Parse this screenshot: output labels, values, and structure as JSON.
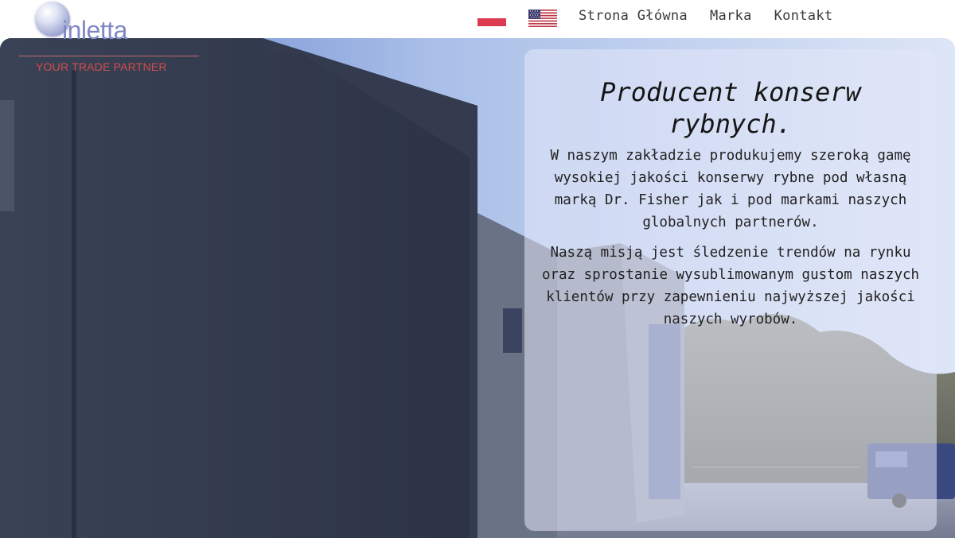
{
  "logo": {
    "word": "inletta",
    "tagline": "YOUR TRADE PARTNER"
  },
  "header": {
    "flags": [
      {
        "name": "polish-flag-icon"
      },
      {
        "name": "us-flag-icon"
      }
    ],
    "nav": [
      {
        "label": "Strona Główna"
      },
      {
        "label": "Marka"
      },
      {
        "label": "Kontakt"
      }
    ]
  },
  "hero": {
    "title": "Producent konserw rybnych.",
    "paragraphs": [
      "W naszym zakładzie produkujemy szeroką gamę wysokiej jakości konserwy rybne pod własną marką Dr. Fisher jak i pod markami naszych globalnych partnerów.",
      "Naszą misją jest śledzenie trendów na rynku oraz sprostanie wysublimowanym gustom naszych klientów przy zapewnieniu najwyższej jakości naszych wyrobów."
    ]
  },
  "colors": {
    "nav_text": "#3a3a3a",
    "logo_blue": "#8088c4",
    "logo_red": "#d24d4d",
    "card_bg": "#e4e8fa"
  }
}
